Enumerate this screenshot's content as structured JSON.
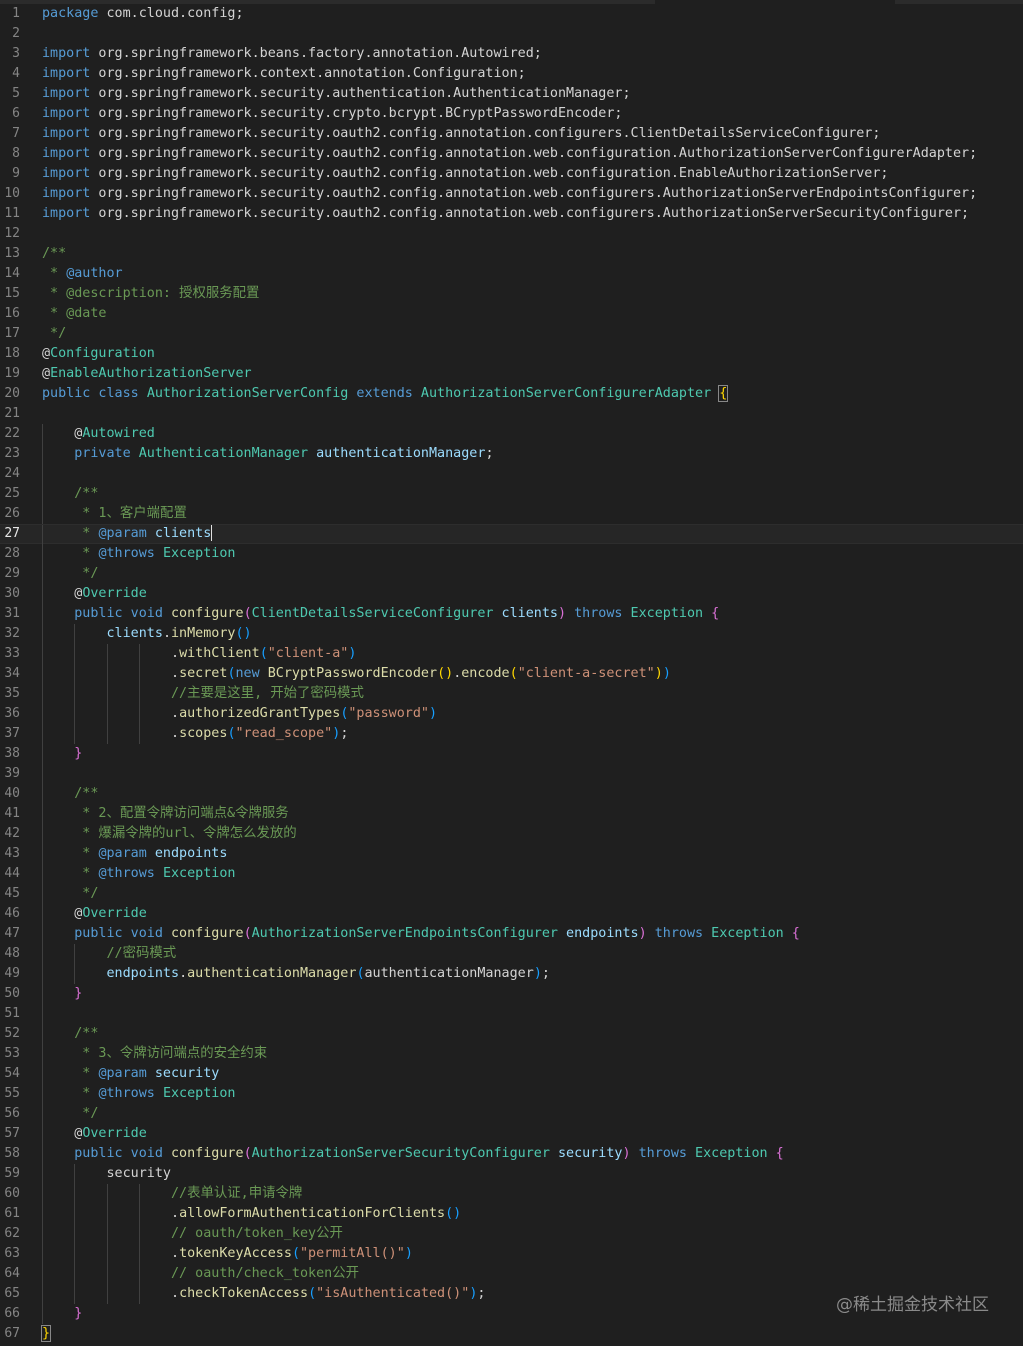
{
  "editor": {
    "active_line": 27,
    "lines": [
      [
        [
          "kw",
          "package"
        ],
        [
          "pl",
          " com.cloud.config;"
        ]
      ],
      [],
      [
        [
          "kw",
          "import"
        ],
        [
          "pl",
          " org.springframework.beans.factory.annotation.Autowired;"
        ]
      ],
      [
        [
          "kw",
          "import"
        ],
        [
          "pl",
          " org.springframework.context.annotation.Configuration;"
        ]
      ],
      [
        [
          "kw",
          "import"
        ],
        [
          "pl",
          " org.springframework.security.authentication.AuthenticationManager;"
        ]
      ],
      [
        [
          "kw",
          "import"
        ],
        [
          "pl",
          " org.springframework.security.crypto.bcrypt.BCryptPasswordEncoder;"
        ]
      ],
      [
        [
          "kw",
          "import"
        ],
        [
          "pl",
          " org.springframework.security.oauth2.config.annotation.configurers.ClientDetailsServiceConfigurer;"
        ]
      ],
      [
        [
          "kw",
          "import"
        ],
        [
          "pl",
          " org.springframework.security.oauth2.config.annotation.web.configuration.AuthorizationServerConfigurerAdapter;"
        ]
      ],
      [
        [
          "kw",
          "import"
        ],
        [
          "pl",
          " org.springframework.security.oauth2.config.annotation.web.configuration.EnableAuthorizationServer;"
        ]
      ],
      [
        [
          "kw",
          "import"
        ],
        [
          "pl",
          " org.springframework.security.oauth2.config.annotation.web.configurers.AuthorizationServerEndpointsConfigurer;"
        ]
      ],
      [
        [
          "kw",
          "import"
        ],
        [
          "pl",
          " org.springframework.security.oauth2.config.annotation.web.configurers.AuthorizationServerSecurityConfigurer;"
        ]
      ],
      [],
      [
        [
          "com",
          "/**"
        ]
      ],
      [
        [
          "com",
          " * "
        ],
        [
          "kw",
          "@author"
        ]
      ],
      [
        [
          "com",
          " * @description: 授权服务配置"
        ]
      ],
      [
        [
          "com",
          " * @date"
        ]
      ],
      [
        [
          "com",
          " */"
        ]
      ],
      [
        [
          "pl",
          "@"
        ],
        [
          "type",
          "Configuration"
        ]
      ],
      [
        [
          "pl",
          "@"
        ],
        [
          "type",
          "EnableAuthorizationServer"
        ]
      ],
      [
        [
          "kw",
          "public class "
        ],
        [
          "type",
          "AuthorizationServerConfig"
        ],
        [
          "kw",
          " extends "
        ],
        [
          "type",
          "AuthorizationServerConfigurerAdapter"
        ],
        [
          "pl",
          " "
        ],
        [
          "br1box",
          "{"
        ]
      ],
      [],
      [
        [
          "pl",
          "    @"
        ],
        [
          "type",
          "Autowired"
        ]
      ],
      [
        [
          "pl",
          "    "
        ],
        [
          "kw",
          "private "
        ],
        [
          "type",
          "AuthenticationManager"
        ],
        [
          "pl",
          " "
        ],
        [
          "var",
          "authenticationManager"
        ],
        [
          "pl",
          ";"
        ]
      ],
      [],
      [
        [
          "com",
          "    /**"
        ]
      ],
      [
        [
          "com",
          "     * 1、客户端配置"
        ]
      ],
      [
        [
          "com",
          "     * "
        ],
        [
          "kw",
          "@param"
        ],
        [
          "pl",
          " "
        ],
        [
          "var",
          "clients"
        ],
        [
          "cursor",
          ""
        ]
      ],
      [
        [
          "com",
          "     * "
        ],
        [
          "kw",
          "@throws"
        ],
        [
          "pl",
          " "
        ],
        [
          "type",
          "Exception"
        ]
      ],
      [
        [
          "com",
          "     */"
        ]
      ],
      [
        [
          "pl",
          "    @"
        ],
        [
          "type",
          "Override"
        ]
      ],
      [
        [
          "pl",
          "    "
        ],
        [
          "kw",
          "public void "
        ],
        [
          "fn",
          "configure"
        ],
        [
          "br2",
          "("
        ],
        [
          "type",
          "ClientDetailsServiceConfigurer"
        ],
        [
          "pl",
          " "
        ],
        [
          "var",
          "clients"
        ],
        [
          "br2",
          ")"
        ],
        [
          "kw",
          " throws "
        ],
        [
          "type",
          "Exception"
        ],
        [
          "pl",
          " "
        ],
        [
          "br2",
          "{"
        ]
      ],
      [
        [
          "pl",
          "        "
        ],
        [
          "var",
          "clients"
        ],
        [
          "pl",
          "."
        ],
        [
          "fn",
          "inMemory"
        ],
        [
          "br3",
          "()"
        ]
      ],
      [
        [
          "pl",
          "                ."
        ],
        [
          "fn",
          "withClient"
        ],
        [
          "br3",
          "("
        ],
        [
          "str",
          "\"client-a\""
        ],
        [
          "br3",
          ")"
        ]
      ],
      [
        [
          "pl",
          "                ."
        ],
        [
          "fn",
          "secret"
        ],
        [
          "br3",
          "("
        ],
        [
          "kw",
          "new "
        ],
        [
          "fn",
          "BCryptPasswordEncoder"
        ],
        [
          "br1",
          "()"
        ],
        [
          "pl",
          "."
        ],
        [
          "fn",
          "encode"
        ],
        [
          "br1",
          "("
        ],
        [
          "str",
          "\"client-a-secret\""
        ],
        [
          "br1",
          ")"
        ],
        [
          "br3",
          ")"
        ]
      ],
      [
        [
          "com",
          "                //主要是这里, 开始了密码模式"
        ]
      ],
      [
        [
          "pl",
          "                ."
        ],
        [
          "fn",
          "authorizedGrantTypes"
        ],
        [
          "br3",
          "("
        ],
        [
          "str",
          "\"password\""
        ],
        [
          "br3",
          ")"
        ]
      ],
      [
        [
          "pl",
          "                ."
        ],
        [
          "fn",
          "scopes"
        ],
        [
          "br3",
          "("
        ],
        [
          "str",
          "\"read_scope\""
        ],
        [
          "br3",
          ")"
        ],
        [
          "pl",
          ";"
        ]
      ],
      [
        [
          "pl",
          "    "
        ],
        [
          "br2",
          "}"
        ]
      ],
      [],
      [
        [
          "com",
          "    /**"
        ]
      ],
      [
        [
          "com",
          "     * 2、配置令牌访问端点&令牌服务"
        ]
      ],
      [
        [
          "com",
          "     * 爆漏令牌的url、令牌怎么发放的"
        ]
      ],
      [
        [
          "com",
          "     * "
        ],
        [
          "kw",
          "@param"
        ],
        [
          "pl",
          " "
        ],
        [
          "var",
          "endpoints"
        ]
      ],
      [
        [
          "com",
          "     * "
        ],
        [
          "kw",
          "@throws"
        ],
        [
          "pl",
          " "
        ],
        [
          "type",
          "Exception"
        ]
      ],
      [
        [
          "com",
          "     */"
        ]
      ],
      [
        [
          "pl",
          "    @"
        ],
        [
          "type",
          "Override"
        ]
      ],
      [
        [
          "pl",
          "    "
        ],
        [
          "kw",
          "public void "
        ],
        [
          "fn",
          "configure"
        ],
        [
          "br2",
          "("
        ],
        [
          "type",
          "AuthorizationServerEndpointsConfigurer"
        ],
        [
          "pl",
          " "
        ],
        [
          "var",
          "endpoints"
        ],
        [
          "br2",
          ")"
        ],
        [
          "kw",
          " throws "
        ],
        [
          "type",
          "Exception"
        ],
        [
          "pl",
          " "
        ],
        [
          "br2",
          "{"
        ]
      ],
      [
        [
          "com",
          "        //密码模式"
        ]
      ],
      [
        [
          "pl",
          "        "
        ],
        [
          "var",
          "endpoints"
        ],
        [
          "pl",
          "."
        ],
        [
          "fn",
          "authenticationManager"
        ],
        [
          "br3",
          "("
        ],
        [
          "pl",
          "authenticationManager"
        ],
        [
          "br3",
          ")"
        ],
        [
          "pl",
          ";"
        ]
      ],
      [
        [
          "pl",
          "    "
        ],
        [
          "br2",
          "}"
        ]
      ],
      [],
      [
        [
          "com",
          "    /**"
        ]
      ],
      [
        [
          "com",
          "     * 3、令牌访问端点的安全约束"
        ]
      ],
      [
        [
          "com",
          "     * "
        ],
        [
          "kw",
          "@param"
        ],
        [
          "pl",
          " "
        ],
        [
          "var",
          "security"
        ]
      ],
      [
        [
          "com",
          "     * "
        ],
        [
          "kw",
          "@throws"
        ],
        [
          "pl",
          " "
        ],
        [
          "type",
          "Exception"
        ]
      ],
      [
        [
          "com",
          "     */"
        ]
      ],
      [
        [
          "pl",
          "    @"
        ],
        [
          "type",
          "Override"
        ]
      ],
      [
        [
          "pl",
          "    "
        ],
        [
          "kw",
          "public void "
        ],
        [
          "fn",
          "configure"
        ],
        [
          "br2",
          "("
        ],
        [
          "type",
          "AuthorizationServerSecurityConfigurer"
        ],
        [
          "pl",
          " "
        ],
        [
          "var",
          "security"
        ],
        [
          "br2",
          ")"
        ],
        [
          "kw",
          " throws "
        ],
        [
          "type",
          "Exception"
        ],
        [
          "pl",
          " "
        ],
        [
          "br2",
          "{"
        ]
      ],
      [
        [
          "pl",
          "        security"
        ]
      ],
      [
        [
          "com",
          "                //表单认证,申请令牌"
        ]
      ],
      [
        [
          "pl",
          "                ."
        ],
        [
          "fn",
          "allowFormAuthenticationForClients"
        ],
        [
          "br3",
          "()"
        ]
      ],
      [
        [
          "com",
          "                // oauth/token_key公开"
        ]
      ],
      [
        [
          "pl",
          "                ."
        ],
        [
          "fn",
          "tokenKeyAccess"
        ],
        [
          "br3",
          "("
        ],
        [
          "str",
          "\"permitAll()\""
        ],
        [
          "br3",
          ")"
        ]
      ],
      [
        [
          "com",
          "                // oauth/check_token公开"
        ]
      ],
      [
        [
          "pl",
          "                ."
        ],
        [
          "fn",
          "checkTokenAccess"
        ],
        [
          "br3",
          "("
        ],
        [
          "str",
          "\"isAuthenticated()\""
        ],
        [
          "br3",
          ")"
        ],
        [
          "pl",
          ";"
        ]
      ],
      [
        [
          "pl",
          "    "
        ],
        [
          "br2",
          "}"
        ]
      ],
      [
        [
          "br1box",
          "}"
        ]
      ]
    ]
  },
  "watermark": "@稀土掘金技术社区"
}
